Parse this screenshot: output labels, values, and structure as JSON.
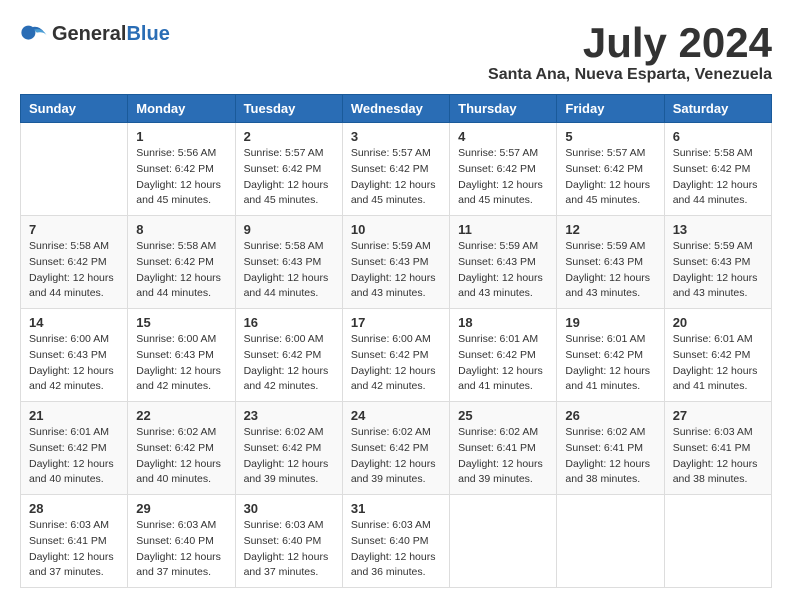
{
  "header": {
    "logo_general": "General",
    "logo_blue": "Blue",
    "month_year": "July 2024",
    "location": "Santa Ana, Nueva Esparta, Venezuela"
  },
  "days_of_week": [
    "Sunday",
    "Monday",
    "Tuesday",
    "Wednesday",
    "Thursday",
    "Friday",
    "Saturday"
  ],
  "weeks": [
    [
      {
        "day": "",
        "info": ""
      },
      {
        "day": "1",
        "info": "Sunrise: 5:56 AM\nSunset: 6:42 PM\nDaylight: 12 hours\nand 45 minutes."
      },
      {
        "day": "2",
        "info": "Sunrise: 5:57 AM\nSunset: 6:42 PM\nDaylight: 12 hours\nand 45 minutes."
      },
      {
        "day": "3",
        "info": "Sunrise: 5:57 AM\nSunset: 6:42 PM\nDaylight: 12 hours\nand 45 minutes."
      },
      {
        "day": "4",
        "info": "Sunrise: 5:57 AM\nSunset: 6:42 PM\nDaylight: 12 hours\nand 45 minutes."
      },
      {
        "day": "5",
        "info": "Sunrise: 5:57 AM\nSunset: 6:42 PM\nDaylight: 12 hours\nand 45 minutes."
      },
      {
        "day": "6",
        "info": "Sunrise: 5:58 AM\nSunset: 6:42 PM\nDaylight: 12 hours\nand 44 minutes."
      }
    ],
    [
      {
        "day": "7",
        "info": "Sunrise: 5:58 AM\nSunset: 6:42 PM\nDaylight: 12 hours\nand 44 minutes."
      },
      {
        "day": "8",
        "info": "Sunrise: 5:58 AM\nSunset: 6:42 PM\nDaylight: 12 hours\nand 44 minutes."
      },
      {
        "day": "9",
        "info": "Sunrise: 5:58 AM\nSunset: 6:43 PM\nDaylight: 12 hours\nand 44 minutes."
      },
      {
        "day": "10",
        "info": "Sunrise: 5:59 AM\nSunset: 6:43 PM\nDaylight: 12 hours\nand 43 minutes."
      },
      {
        "day": "11",
        "info": "Sunrise: 5:59 AM\nSunset: 6:43 PM\nDaylight: 12 hours\nand 43 minutes."
      },
      {
        "day": "12",
        "info": "Sunrise: 5:59 AM\nSunset: 6:43 PM\nDaylight: 12 hours\nand 43 minutes."
      },
      {
        "day": "13",
        "info": "Sunrise: 5:59 AM\nSunset: 6:43 PM\nDaylight: 12 hours\nand 43 minutes."
      }
    ],
    [
      {
        "day": "14",
        "info": "Sunrise: 6:00 AM\nSunset: 6:43 PM\nDaylight: 12 hours\nand 42 minutes."
      },
      {
        "day": "15",
        "info": "Sunrise: 6:00 AM\nSunset: 6:43 PM\nDaylight: 12 hours\nand 42 minutes."
      },
      {
        "day": "16",
        "info": "Sunrise: 6:00 AM\nSunset: 6:42 PM\nDaylight: 12 hours\nand 42 minutes."
      },
      {
        "day": "17",
        "info": "Sunrise: 6:00 AM\nSunset: 6:42 PM\nDaylight: 12 hours\nand 42 minutes."
      },
      {
        "day": "18",
        "info": "Sunrise: 6:01 AM\nSunset: 6:42 PM\nDaylight: 12 hours\nand 41 minutes."
      },
      {
        "day": "19",
        "info": "Sunrise: 6:01 AM\nSunset: 6:42 PM\nDaylight: 12 hours\nand 41 minutes."
      },
      {
        "day": "20",
        "info": "Sunrise: 6:01 AM\nSunset: 6:42 PM\nDaylight: 12 hours\nand 41 minutes."
      }
    ],
    [
      {
        "day": "21",
        "info": "Sunrise: 6:01 AM\nSunset: 6:42 PM\nDaylight: 12 hours\nand 40 minutes."
      },
      {
        "day": "22",
        "info": "Sunrise: 6:02 AM\nSunset: 6:42 PM\nDaylight: 12 hours\nand 40 minutes."
      },
      {
        "day": "23",
        "info": "Sunrise: 6:02 AM\nSunset: 6:42 PM\nDaylight: 12 hours\nand 39 minutes."
      },
      {
        "day": "24",
        "info": "Sunrise: 6:02 AM\nSunset: 6:42 PM\nDaylight: 12 hours\nand 39 minutes."
      },
      {
        "day": "25",
        "info": "Sunrise: 6:02 AM\nSunset: 6:41 PM\nDaylight: 12 hours\nand 39 minutes."
      },
      {
        "day": "26",
        "info": "Sunrise: 6:02 AM\nSunset: 6:41 PM\nDaylight: 12 hours\nand 38 minutes."
      },
      {
        "day": "27",
        "info": "Sunrise: 6:03 AM\nSunset: 6:41 PM\nDaylight: 12 hours\nand 38 minutes."
      }
    ],
    [
      {
        "day": "28",
        "info": "Sunrise: 6:03 AM\nSunset: 6:41 PM\nDaylight: 12 hours\nand 37 minutes."
      },
      {
        "day": "29",
        "info": "Sunrise: 6:03 AM\nSunset: 6:40 PM\nDaylight: 12 hours\nand 37 minutes."
      },
      {
        "day": "30",
        "info": "Sunrise: 6:03 AM\nSunset: 6:40 PM\nDaylight: 12 hours\nand 37 minutes."
      },
      {
        "day": "31",
        "info": "Sunrise: 6:03 AM\nSunset: 6:40 PM\nDaylight: 12 hours\nand 36 minutes."
      },
      {
        "day": "",
        "info": ""
      },
      {
        "day": "",
        "info": ""
      },
      {
        "day": "",
        "info": ""
      }
    ]
  ]
}
